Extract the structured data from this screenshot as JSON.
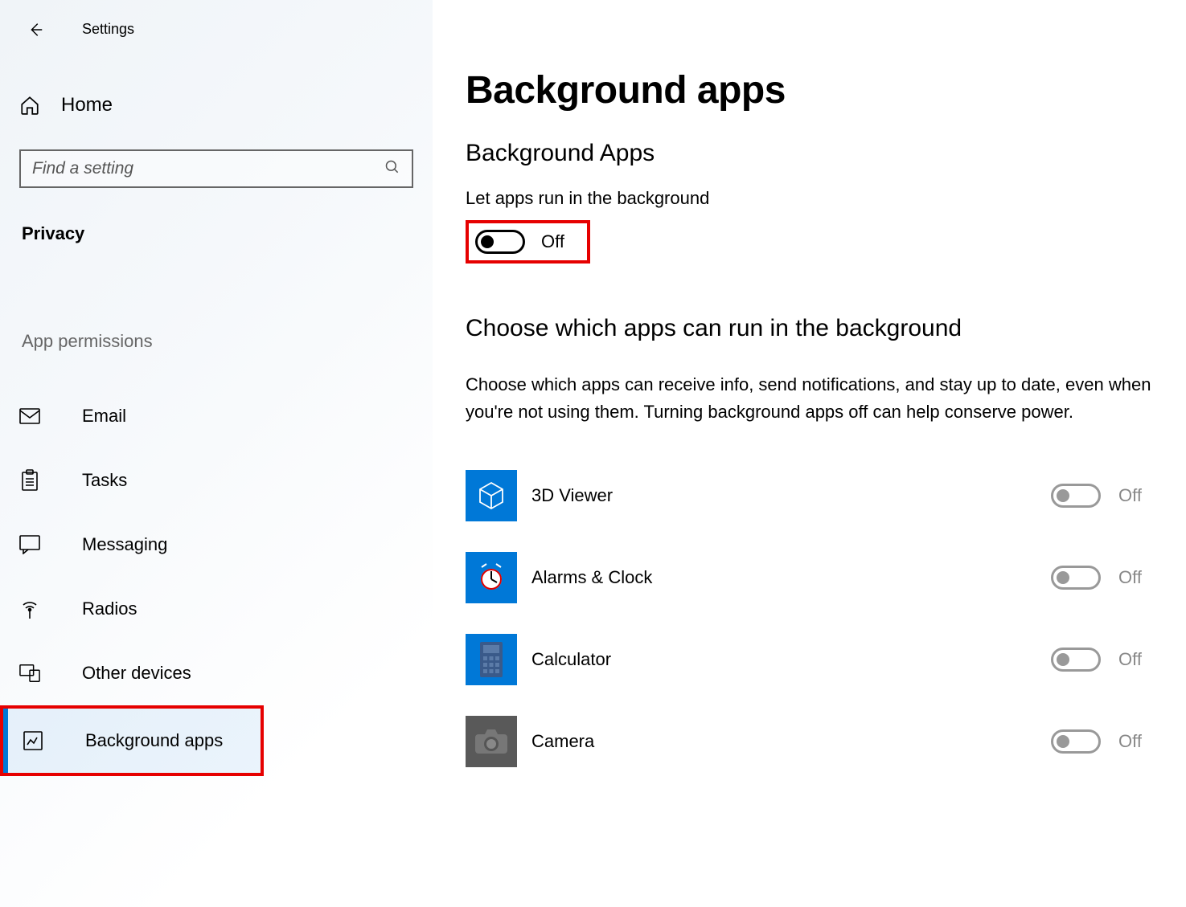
{
  "header": {
    "title": "Settings"
  },
  "sidebar": {
    "home_label": "Home",
    "search_placeholder": "Find a setting",
    "section": "Privacy",
    "subsection": "App permissions",
    "items": [
      {
        "label": "Email",
        "icon": "email"
      },
      {
        "label": "Tasks",
        "icon": "tasks"
      },
      {
        "label": "Messaging",
        "icon": "messaging"
      },
      {
        "label": "Radios",
        "icon": "radios"
      },
      {
        "label": "Other devices",
        "icon": "other-devices"
      },
      {
        "label": "Background apps",
        "icon": "background-apps",
        "selected": true
      }
    ]
  },
  "main": {
    "page_title": "Background apps",
    "section1_title": "Background Apps",
    "setting_label": "Let apps run in the background",
    "main_toggle_state": "Off",
    "section2_title": "Choose which apps can run in the background",
    "description": "Choose which apps can receive info, send notifications, and stay up to date, even when you're not using them. Turning background apps off can help conserve power.",
    "apps": [
      {
        "name": "3D Viewer",
        "state": "Off",
        "icon": "3d-viewer",
        "color": "blue"
      },
      {
        "name": "Alarms & Clock",
        "state": "Off",
        "icon": "alarms-clock",
        "color": "blue"
      },
      {
        "name": "Calculator",
        "state": "Off",
        "icon": "calculator",
        "color": "blue"
      },
      {
        "name": "Camera",
        "state": "Off",
        "icon": "camera",
        "color": "gray"
      }
    ]
  }
}
